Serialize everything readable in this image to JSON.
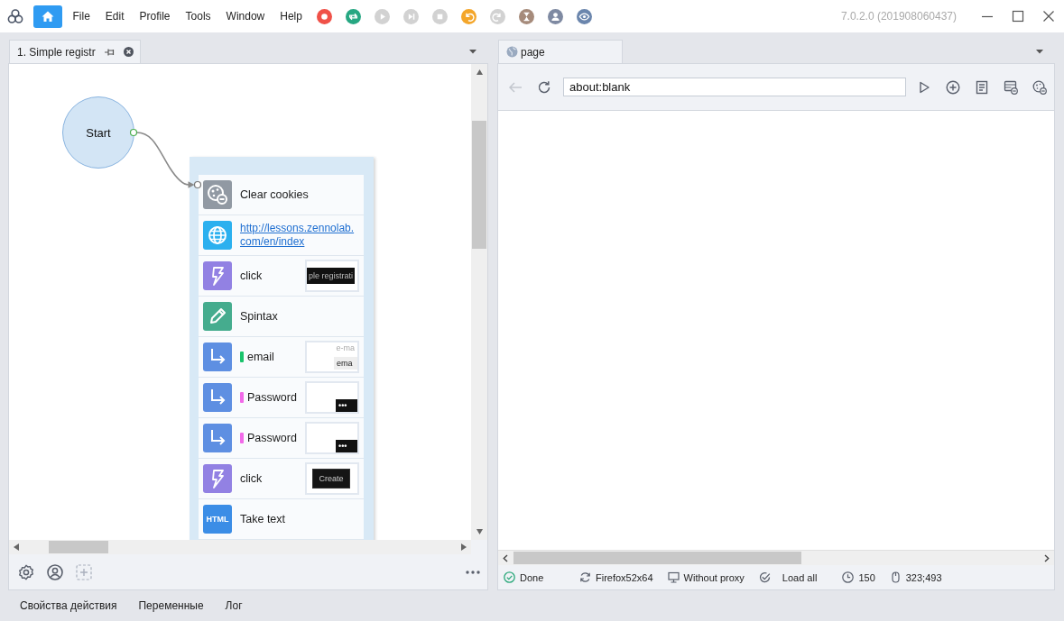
{
  "titlebar": {
    "menu": [
      "File",
      "Edit",
      "Profile",
      "Tools",
      "Window",
      "Help"
    ],
    "actions": [
      {
        "kind": "record",
        "disabled": false
      },
      {
        "kind": "repeat",
        "disabled": false
      },
      {
        "kind": "play",
        "disabled": true
      },
      {
        "kind": "step",
        "disabled": true
      },
      {
        "kind": "stop",
        "disabled": true
      },
      {
        "kind": "undo",
        "disabled": false
      },
      {
        "kind": "redo",
        "disabled": true
      },
      {
        "kind": "timer",
        "disabled": false
      },
      {
        "kind": "profile",
        "disabled": false
      },
      {
        "kind": "view",
        "disabled": false
      }
    ],
    "version": "7.0.2.0 (201908060437)"
  },
  "project_panel": {
    "tabs": [
      {
        "label": "1. Simple registr",
        "selected": true
      }
    ],
    "canvas": {
      "start_node": {
        "label": "Start"
      },
      "actions": [
        {
          "kind": "cookies",
          "label": "Clear cookies"
        },
        {
          "kind": "navigate",
          "label": "http://lessons.zennolab.com/en/index"
        },
        {
          "kind": "click",
          "label": "click",
          "preview": {
            "kind": "banner",
            "text": "ple registrati"
          }
        },
        {
          "kind": "spintax",
          "label": "Spintax"
        },
        {
          "kind": "input",
          "label": "email",
          "color": "#19c36b",
          "preview": {
            "kind": "field",
            "caption": "e-ma",
            "text": "ema"
          }
        },
        {
          "kind": "input",
          "label": "Password",
          "color": "#f26ae9",
          "preview": {
            "kind": "password",
            "text": "•••"
          }
        },
        {
          "kind": "input",
          "label": "Password",
          "color": "#f26ae9",
          "preview": {
            "kind": "password",
            "text": "•••"
          }
        },
        {
          "kind": "click",
          "label": "click",
          "preview": {
            "kind": "button",
            "text": "Create"
          }
        },
        {
          "kind": "html",
          "label": "Take text",
          "icon_text": "HTML"
        }
      ]
    }
  },
  "browser_panel": {
    "tabs": [
      {
        "label": "page",
        "selected": true
      }
    ],
    "back": {
      "disabled": true
    },
    "address": {
      "value": "about:blank"
    },
    "status_bar": [
      {
        "kind": "done",
        "text": "Done"
      },
      {
        "kind": "browser",
        "text": "Firefox52x64"
      },
      {
        "kind": "proxy",
        "text": "Without proxy"
      },
      {
        "kind": "load",
        "text": "Load all"
      },
      {
        "kind": "timeout",
        "text": "150"
      },
      {
        "kind": "cursor",
        "text": "323;493"
      }
    ]
  },
  "bottom_tabs": [
    {
      "label": "Свойства действия",
      "selected": false
    },
    {
      "label": "Переменные",
      "selected": false
    },
    {
      "label": "Лог",
      "selected": false
    }
  ]
}
